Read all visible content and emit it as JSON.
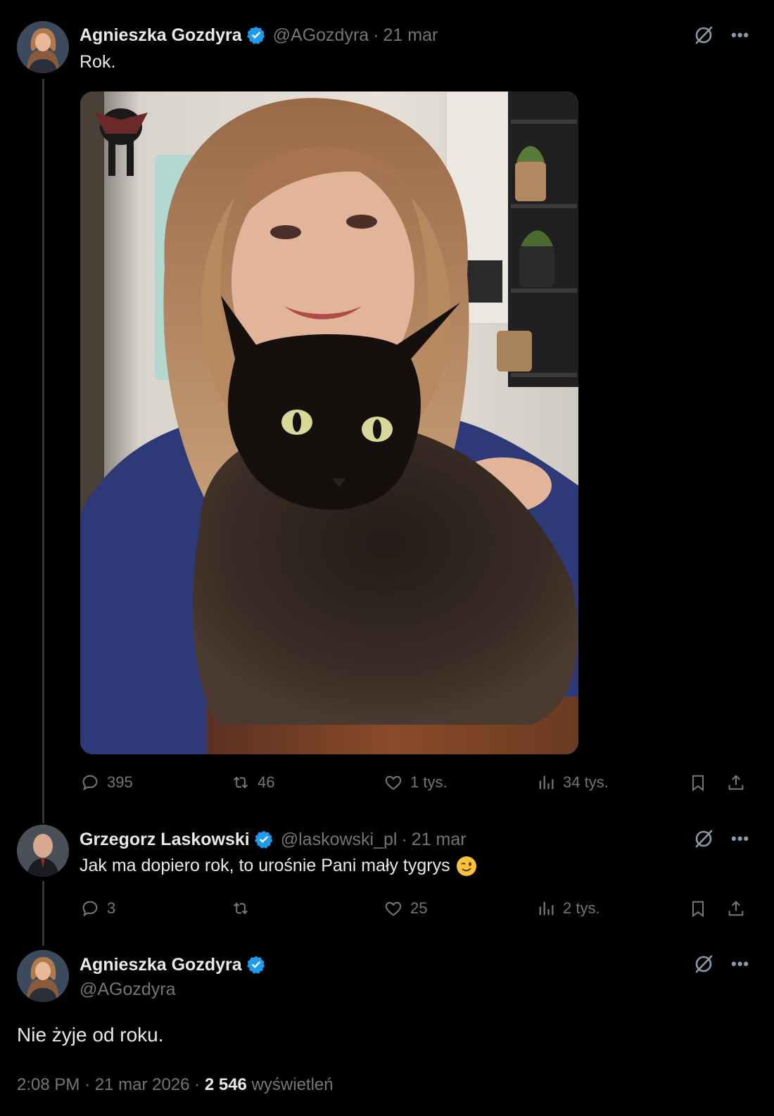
{
  "tweet1": {
    "author_name": "Agnieszka Gozdyra",
    "handle": "@AGozdyra",
    "separator": "·",
    "date": "21 mar",
    "text": "Rok.",
    "actions": {
      "replies": "395",
      "reposts": "46",
      "likes": "1 tys.",
      "views": "34 tys."
    }
  },
  "tweet2": {
    "author_name": "Grzegorz Laskowski",
    "handle": "@laskowski_pl",
    "separator": "·",
    "date": "21 mar",
    "text": "Jak ma dopiero rok, to urośnie Pani mały tygrys",
    "emoji": "winking-face",
    "actions": {
      "replies": "3",
      "reposts": "",
      "likes": "25",
      "views": "2 tys."
    }
  },
  "tweet3": {
    "author_name": "Agnieszka Gozdyra",
    "handle": "@AGozdyra",
    "text": "Nie żyje od roku.",
    "time": "2:08 PM",
    "separator": "·",
    "date": "21 mar 2026",
    "views_count": "2 546",
    "views_label": "wyświetleń"
  },
  "icons": {
    "verified": "verified-badge-icon",
    "grok": "grok-icon",
    "more": "more-icon",
    "reply": "reply-icon",
    "repost": "repost-icon",
    "like": "like-icon",
    "views": "views-icon",
    "bookmark": "bookmark-icon",
    "share": "share-icon"
  },
  "colors": {
    "background": "#000000",
    "text": "#e7e9ea",
    "muted": "#71767b",
    "verified": "#1d9bf0",
    "thread_line": "#333639"
  }
}
